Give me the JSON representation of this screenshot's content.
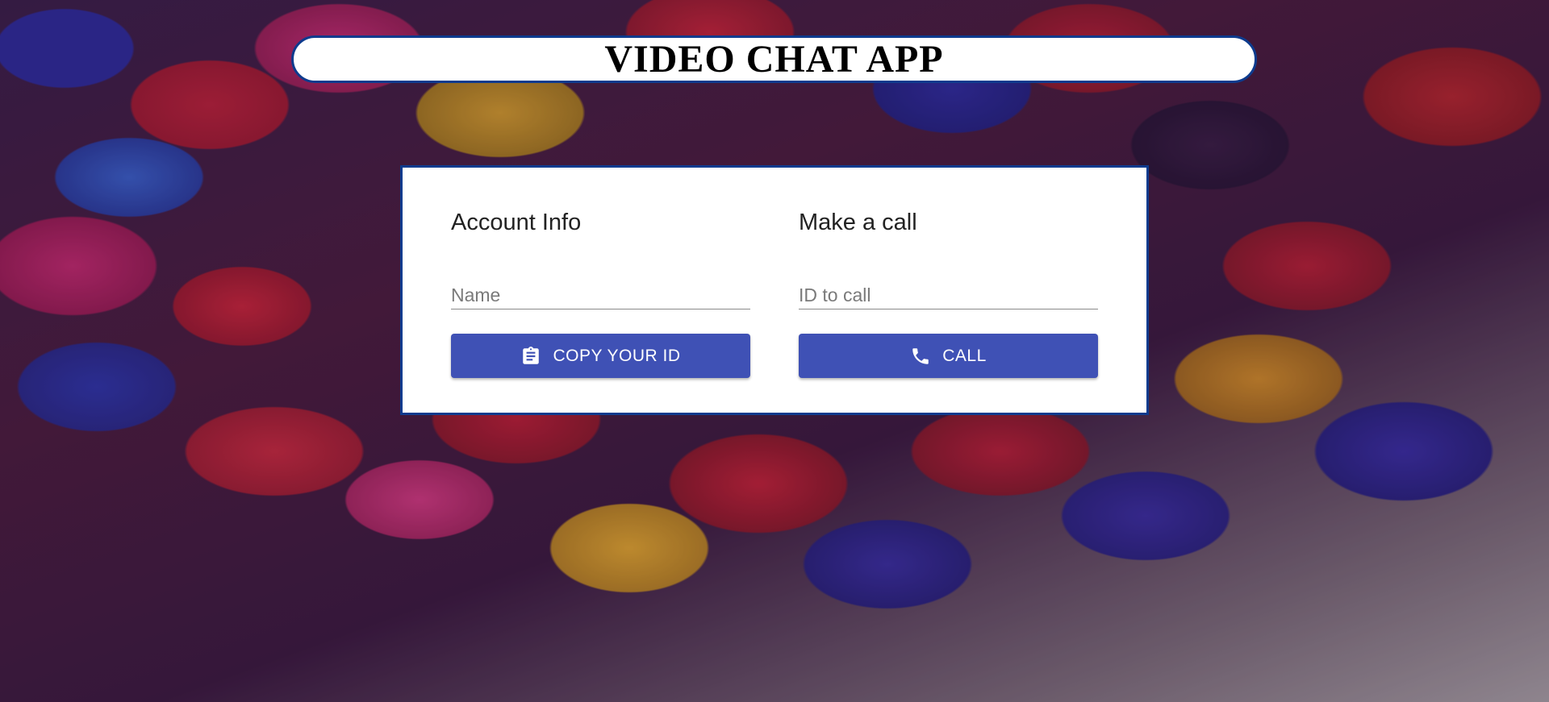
{
  "header": {
    "title": "VIDEO CHAT APP"
  },
  "account": {
    "heading": "Account Info",
    "name_placeholder": "Name",
    "name_value": "",
    "copy_button": {
      "label": "COPY YOUR ID",
      "icon": "clipboard-icon"
    }
  },
  "call": {
    "heading": "Make a call",
    "id_placeholder": "ID to call",
    "id_value": "",
    "call_button": {
      "label": "CALL",
      "icon": "phone-icon"
    }
  },
  "colors": {
    "frame_border": "#0d3b8e",
    "button_bg": "#3f51b5",
    "card_bg": "#ffffff"
  }
}
